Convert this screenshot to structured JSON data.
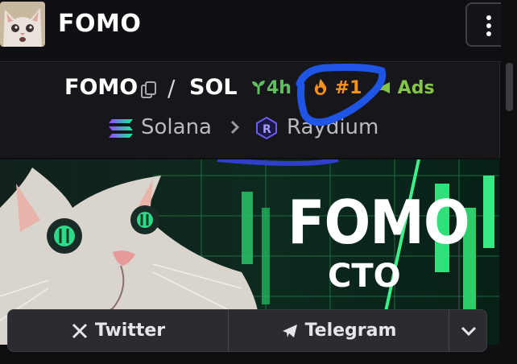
{
  "header": {
    "title": "FOMO"
  },
  "pair": {
    "base": "FOMO",
    "separator": "/",
    "quote": "SOL",
    "age": "4h",
    "rank": "#1",
    "ads_label": "Ads"
  },
  "chain": {
    "name": "Solana",
    "dex": "Raydium"
  },
  "banner": {
    "headline": "FOMO",
    "subline": "CTO"
  },
  "socials": {
    "twitter": "Twitter",
    "telegram": "Telegram"
  },
  "colors": {
    "age_green": "#5fbf5f",
    "rank_orange": "#f7931a",
    "ads_green": "#85c44a",
    "annotation_blue": "#1f55e6"
  }
}
